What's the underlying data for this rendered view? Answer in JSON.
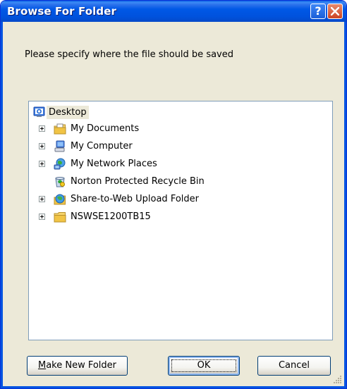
{
  "window": {
    "title": "Browse For Folder",
    "help_label": "?"
  },
  "prompt": "Please specify where the file should be saved",
  "tree": {
    "root": {
      "label": "Desktop",
      "icon": "desktop-icon",
      "selected": true
    },
    "items": [
      {
        "label": "My Documents",
        "icon": "my-documents-icon",
        "expandable": true
      },
      {
        "label": "My Computer",
        "icon": "my-computer-icon",
        "expandable": true
      },
      {
        "label": "My Network Places",
        "icon": "network-places-icon",
        "expandable": true
      },
      {
        "label": "Norton Protected Recycle Bin",
        "icon": "recycle-bin-icon",
        "expandable": false
      },
      {
        "label": "Share-to-Web Upload Folder",
        "icon": "share-web-folder-icon",
        "expandable": true
      },
      {
        "label": "NSWSE1200TB15",
        "icon": "folder-icon",
        "expandable": true
      }
    ]
  },
  "buttons": {
    "make_new_folder": "Make New Folder",
    "ok": "OK",
    "cancel": "Cancel"
  },
  "colors": {
    "titlebar": "#0058e6",
    "dialog_bg": "#ece9d8",
    "tree_border": "#7f9db9"
  }
}
